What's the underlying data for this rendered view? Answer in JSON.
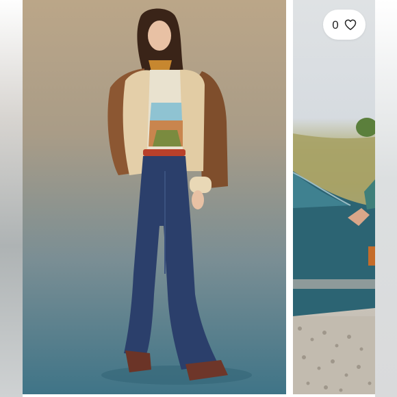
{
  "listing": {
    "images": [
      {
        "subject": "model-in-flare-jeans"
      },
      {
        "subject": "arm-on-teal-car"
      }
    ]
  },
  "likes": {
    "count": "0",
    "icon": "heart-outline-icon"
  },
  "colors": {
    "page_background": "#ffffff",
    "pill_background": "#ffffff",
    "text": "#222222"
  }
}
